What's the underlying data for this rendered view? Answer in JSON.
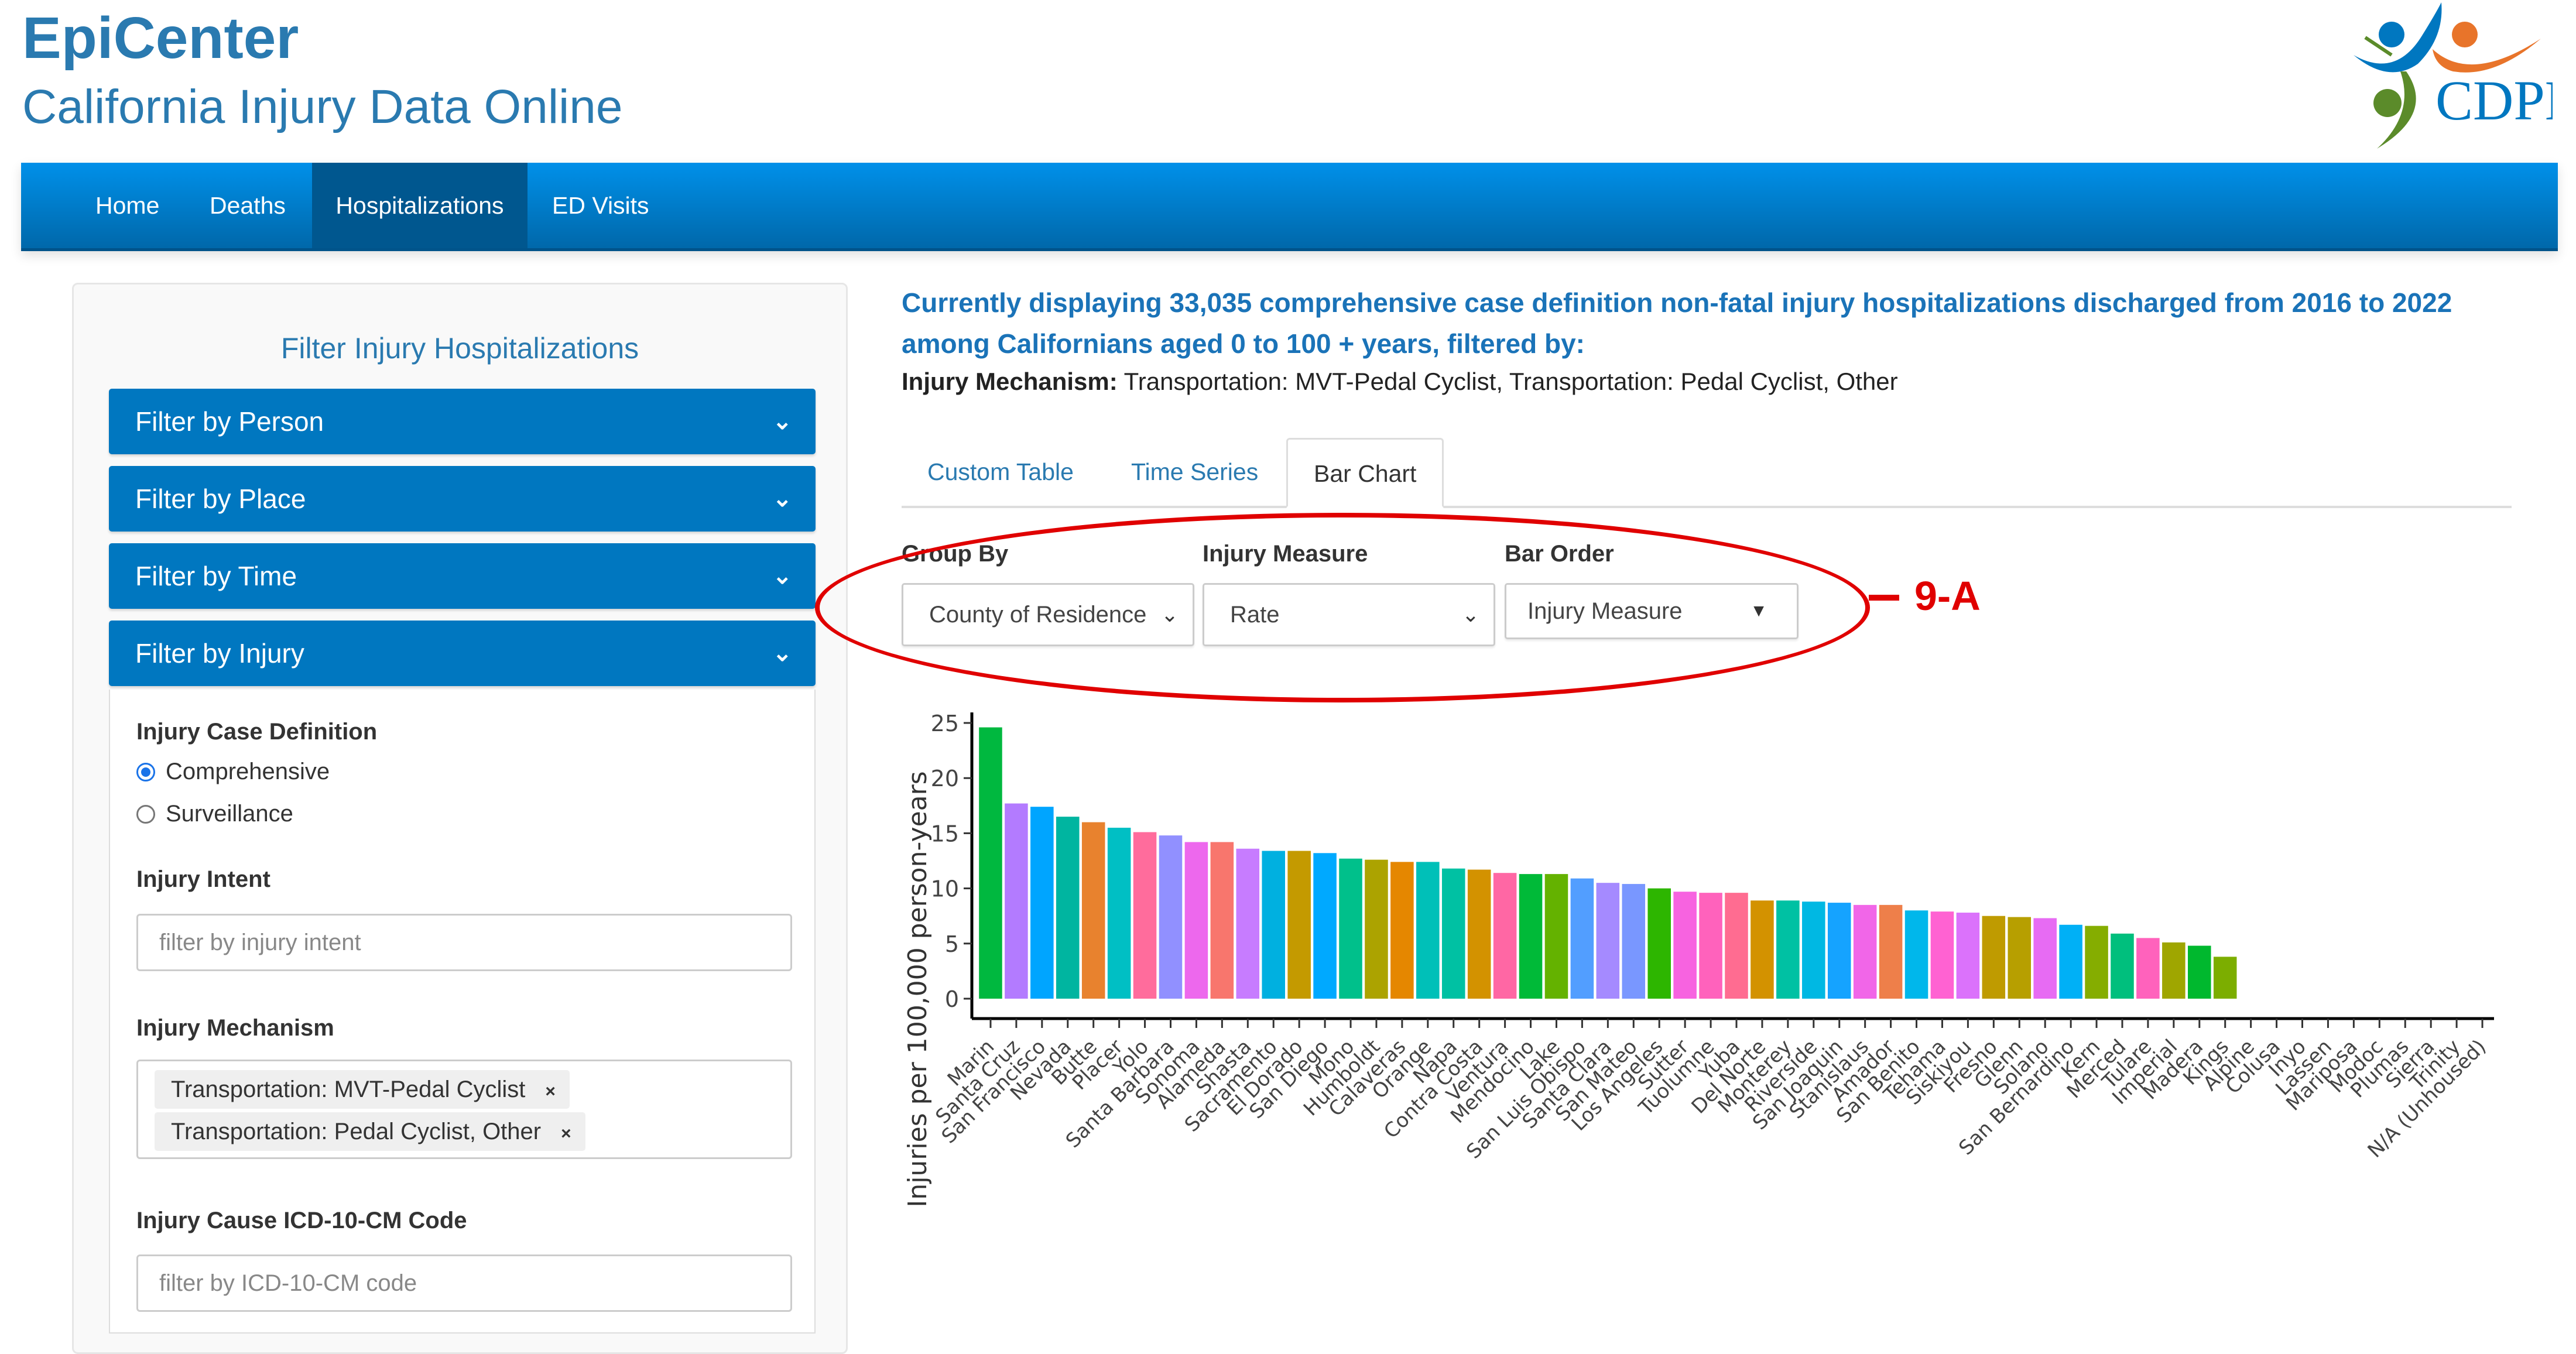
{
  "header": {
    "title": "EpiCenter",
    "subtitle": "California Injury Data Online",
    "logo_text": "CDPH",
    "logo_icon": "cdph-logo-icon"
  },
  "nav": {
    "items": [
      {
        "label": "Home",
        "active": false
      },
      {
        "label": "Deaths",
        "active": false
      },
      {
        "label": "Hospitalizations",
        "active": true
      },
      {
        "label": "ED Visits",
        "active": false
      }
    ]
  },
  "sidebar": {
    "heading": "Filter Injury Hospitalizations",
    "accordions": [
      {
        "label": "Filter by Person",
        "icon": "chevron-down-icon"
      },
      {
        "label": "Filter by Place",
        "icon": "chevron-down-icon"
      },
      {
        "label": "Filter by Time",
        "icon": "chevron-down-icon"
      },
      {
        "label": "Filter by Injury",
        "icon": "chevron-down-icon"
      }
    ],
    "injury": {
      "case_definition_label": "Injury Case Definition",
      "case_definition_options": [
        {
          "label": "Comprehensive",
          "checked": true
        },
        {
          "label": "Surveillance",
          "checked": false
        }
      ],
      "intent_label": "Injury Intent",
      "intent_placeholder": "filter by injury intent",
      "mechanism_label": "Injury Mechanism",
      "mechanism_selected": [
        "Transportation: MVT-Pedal Cyclist",
        "Transportation: Pedal Cyclist, Other"
      ],
      "chip_remove": "×",
      "icd_label": "Injury Cause ICD-10-CM Code",
      "icd_placeholder": "filter by ICD-10-CM code"
    }
  },
  "main": {
    "summary": "Currently displaying 33,035 comprehensive case definition non-fatal injury hospitalizations discharged from 2016 to 2022 among Californians aged 0 to 100 + years, filtered by:",
    "filter_key": "Injury Mechanism:",
    "filter_value": " Transportation: MVT-Pedal Cyclist, Transportation: Pedal Cyclist, Other",
    "tabs": [
      {
        "label": "Custom Table",
        "active": false
      },
      {
        "label": "Time Series",
        "active": false
      },
      {
        "label": "Bar Chart",
        "active": true
      }
    ],
    "controls": {
      "group_by_label": "Group By",
      "group_by_value": "County of Residence",
      "measure_label": "Injury Measure",
      "measure_value": "Rate",
      "order_label": "Bar Order",
      "order_value": "Injury Measure"
    },
    "annotation": {
      "label": "9-A",
      "color": "#e00000"
    }
  },
  "colors": {
    "brand_blue": "#2a7ab0",
    "nav_top": "#0090e9",
    "nav_bottom": "#0068aa",
    "nav_active": "#00578f",
    "accordion": "#0077c0"
  },
  "chart_data": {
    "type": "bar",
    "title": "",
    "xlabel": "",
    "ylabel": "Injuries per 100,000 person-years",
    "ylim": [
      0,
      25
    ],
    "yticks": [
      0,
      5,
      10,
      15,
      20,
      25
    ],
    "grid": false,
    "legend": "none",
    "categories": [
      "Marin",
      "Santa Cruz",
      "San Francisco",
      "Nevada",
      "Butte",
      "Placer",
      "Yolo",
      "Santa Barbara",
      "Sonoma",
      "Alameda",
      "Shasta",
      "Sacramento",
      "El Dorado",
      "San Diego",
      "Mono",
      "Humboldt",
      "Calaveras",
      "Orange",
      "Napa",
      "Contra Costa",
      "Ventura",
      "Mendocino",
      "Lake",
      "San Luis Obispo",
      "Santa Clara",
      "San Mateo",
      "Los Angeles",
      "Sutter",
      "Tuolumne",
      "Yuba",
      "Del Norte",
      "Monterey",
      "Riverside",
      "San Joaquin",
      "Stanislaus",
      "Amador",
      "San Benito",
      "Tehama",
      "Siskiyou",
      "Fresno",
      "Glenn",
      "Solano",
      "San Bernardino",
      "Kern",
      "Merced",
      "Tulare",
      "Imperial",
      "Madera",
      "Kings",
      "Alpine",
      "Colusa",
      "Inyo",
      "Lassen",
      "Mariposa",
      "Modoc",
      "Plumas",
      "Sierra",
      "Trinity",
      "N/A (Unhoused)"
    ],
    "values": [
      24.6,
      17.7,
      17.4,
      16.5,
      16.0,
      15.5,
      15.1,
      14.8,
      14.2,
      14.2,
      13.6,
      13.4,
      13.4,
      13.2,
      12.7,
      12.6,
      12.4,
      12.4,
      11.8,
      11.7,
      11.4,
      11.3,
      11.3,
      10.9,
      10.5,
      10.4,
      10.0,
      9.7,
      9.6,
      9.6,
      8.9,
      8.9,
      8.8,
      8.7,
      8.5,
      8.5,
      8.0,
      7.9,
      7.8,
      7.5,
      7.4,
      7.3,
      6.7,
      6.6,
      5.9,
      5.5,
      5.1,
      4.8,
      3.8,
      null,
      null,
      null,
      null,
      null,
      null,
      null,
      null,
      null,
      null
    ],
    "bar_colors": [
      "#00b83f",
      "#b37bff",
      "#00a5ff",
      "#00b5a0",
      "#e8822e",
      "#00bfc4",
      "#ff6c9c",
      "#9190ff",
      "#ed68ed",
      "#f8766d",
      "#c77cff",
      "#00b0e0",
      "#c49a00",
      "#00a9ff",
      "#00c08b",
      "#aca300",
      "#e58700",
      "#00c0b8",
      "#00c1a3",
      "#d39200",
      "#ff67a4",
      "#00ba38",
      "#64b200",
      "#529eff",
      "#a58aff",
      "#7997ff",
      "#2db600",
      "#f763e0",
      "#ff62bc",
      "#ff6c91",
      "#d39200",
      "#00c1a3",
      "#00b8e3",
      "#15a3ff",
      "#f166e8",
      "#ee7f4a",
      "#00b7eb",
      "#ff62d2",
      "#db72fb",
      "#bf9b00",
      "#b79f00",
      "#e76bf3",
      "#00b0f6",
      "#85ad00",
      "#00bf7d",
      "#ff62bc",
      "#9fa600",
      "#00b82e",
      "#7cae00"
    ]
  }
}
